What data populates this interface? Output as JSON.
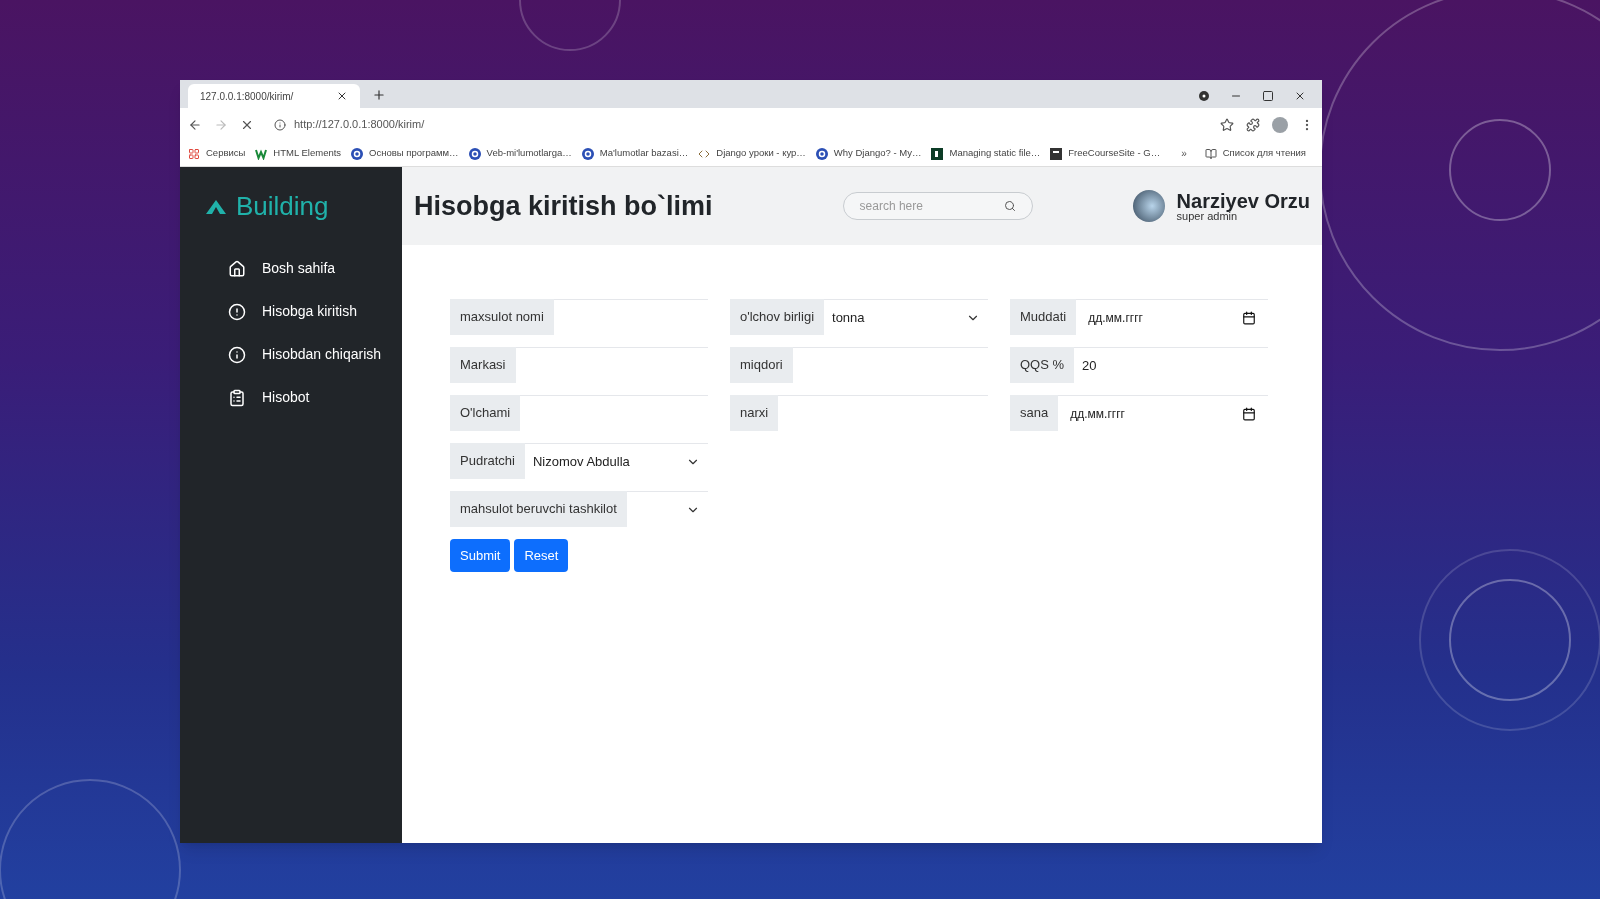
{
  "browser": {
    "tab_title": "127.0.0.1:8000/kirim/",
    "url": "http://127.0.0.1:8000/kirim/",
    "bookmarks": [
      {
        "kind": "apps",
        "label": "Сервисы"
      },
      {
        "kind": "w",
        "label": "HTML Elements"
      },
      {
        "kind": "c",
        "label": "Основы программ…"
      },
      {
        "kind": "c",
        "label": "Veb-mi'lumotlarga…"
      },
      {
        "kind": "c",
        "label": "Ma'lumotlar bazasi…"
      },
      {
        "kind": "code",
        "label": "Django уроки - кур…"
      },
      {
        "kind": "c",
        "label": "Why Django? - My…"
      },
      {
        "kind": "dj",
        "label": "Managing static file…"
      },
      {
        "kind": "fc",
        "label": "FreeCourseSite - G…"
      }
    ],
    "overflow": "»",
    "reading_list": "Список для чтения"
  },
  "sidebar": {
    "brand": "Building",
    "items": [
      {
        "kind": "home",
        "label": "Bosh sahifa"
      },
      {
        "kind": "in",
        "label": "Hisobga kiritish"
      },
      {
        "kind": "out",
        "label": "Hisobdan chiqarish"
      },
      {
        "kind": "report",
        "label": "Hisobot"
      }
    ]
  },
  "header": {
    "title": "Hisobga kiritish bo`limi",
    "search_placeholder": "search here",
    "user_name": "Narziyev Orzu",
    "user_role": "super admin"
  },
  "form": {
    "columns": [
      [
        {
          "kind": "text",
          "label": "maxsulot nomi"
        },
        {
          "kind": "text",
          "label": "Markasi"
        },
        {
          "kind": "text",
          "label": "O'lchami"
        },
        {
          "kind": "select",
          "label": "Pudratchi",
          "value": "Nizomov Abdulla"
        },
        {
          "kind": "select",
          "label": "mahsulot beruvchi tashkilot"
        }
      ],
      [
        {
          "kind": "select",
          "label": "o'lchov birligi",
          "value": "tonna"
        },
        {
          "kind": "text",
          "label": "miqdori"
        },
        {
          "kind": "text",
          "label": "narxi"
        }
      ],
      [
        {
          "kind": "date",
          "label": "Muddati",
          "value": "дд.мм.гггг"
        },
        {
          "kind": "text",
          "label": "QQS %",
          "value": "20"
        },
        {
          "kind": "date",
          "label": "sana",
          "value": "дд.мм.гггг"
        }
      ]
    ],
    "buttons": [
      "Submit",
      "Reset"
    ]
  }
}
